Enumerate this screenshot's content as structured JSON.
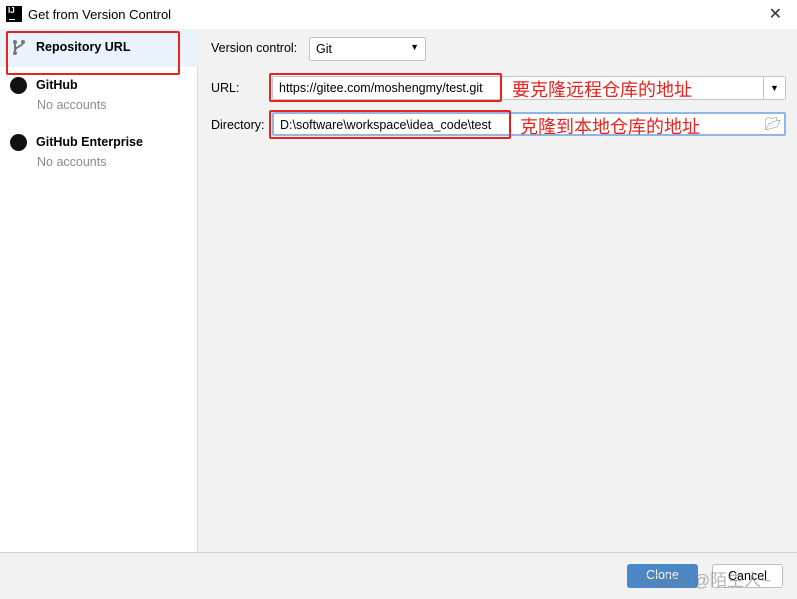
{
  "window": {
    "title": "Get from Version Control"
  },
  "sidebar": {
    "items": [
      {
        "label": "Repository URL",
        "sub": ""
      },
      {
        "label": "GitHub",
        "sub": "No accounts"
      },
      {
        "label": "GitHub Enterprise",
        "sub": "No accounts"
      }
    ]
  },
  "form": {
    "vc_label": "Version control:",
    "vc_value": "Git",
    "url_label": "URL:",
    "url_value": "https://gitee.com/moshengmy/test.git",
    "dir_label": "Directory:",
    "dir_value": "D:\\software\\workspace\\idea_code\\test"
  },
  "annotations": {
    "url": "要克隆远程仓库的地址",
    "dir": "克隆到本地仓库的地址",
    "color": "#e8221e"
  },
  "buttons": {
    "clone": "Clone",
    "cancel": "Cancel"
  },
  "watermark": "CSDN @陌生人~",
  "colors": {
    "accent": "#4a88c7",
    "selected": "#eaf2fc"
  }
}
